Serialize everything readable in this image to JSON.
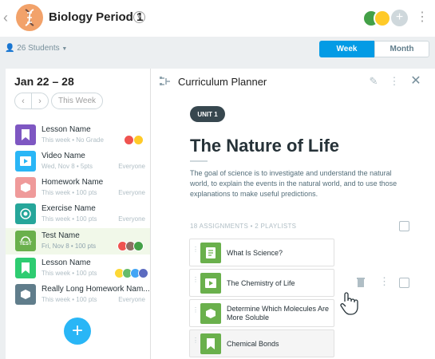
{
  "header": {
    "class_name": "Biology Period 1",
    "students": "26 Students",
    "view_tabs": [
      "Week",
      "Month"
    ],
    "selected_view": "Week"
  },
  "week": {
    "date_range": "Jan 22 – 28",
    "this_week_label": "This Week"
  },
  "assignments": [
    {
      "name": "Lesson Name",
      "meta": "This week • No Grade",
      "right": "",
      "icon": "bookmark-icon",
      "color": "#7e57c2"
    },
    {
      "name": "Video Name",
      "meta": "Wed, Nov 8 • 5pts",
      "right": "Everyone",
      "icon": "play-icon",
      "color": "#29b6f6"
    },
    {
      "name": "Homework Name",
      "meta": "This week • 100 pts",
      "right": "Everyone",
      "icon": "homework-icon",
      "color": "#ef9a9a"
    },
    {
      "name": "Exercise Name",
      "meta": "This week • 100 pts",
      "right": "Everyone",
      "icon": "target-icon",
      "color": "#26a69a"
    },
    {
      "name": "Test Name",
      "meta": "Fri, Nov 8 • 100 pts",
      "right": "",
      "icon": "test-icon",
      "color": "#6ab04c",
      "badge": "TEST"
    },
    {
      "name": "Lesson Name",
      "meta": "This week • 100 pts",
      "right": "",
      "icon": "bookmark-icon",
      "color": "#2ecc71"
    },
    {
      "name": "Really Long Homework Nam...",
      "meta": "This week • 100 pts",
      "right": "Everyone",
      "icon": "homework-icon",
      "color": "#607d8b"
    }
  ],
  "planner": {
    "title": "Curriculum Planner",
    "unit_label": "UNIT 1",
    "unit_title": "The Nature of Life",
    "description": "The goal of science is to investigate and understand the natural world, to explain the events in the natural world, and to use those explanations to make useful predictions.",
    "count_label": "18 ASSIGNMENTS • 2 PLAYLISTS",
    "items": [
      {
        "name": "What Is Science?",
        "icon": "document-icon"
      },
      {
        "name": "The Chemistry of Life",
        "icon": "play-icon"
      },
      {
        "name": "Determine Which Molecules Are More Soluble",
        "icon": "homework-icon"
      },
      {
        "name": "Chemical Bonds",
        "icon": "bookmark-icon"
      }
    ]
  },
  "colors": {
    "accent": "#039be5",
    "green": "#6ab04c"
  }
}
